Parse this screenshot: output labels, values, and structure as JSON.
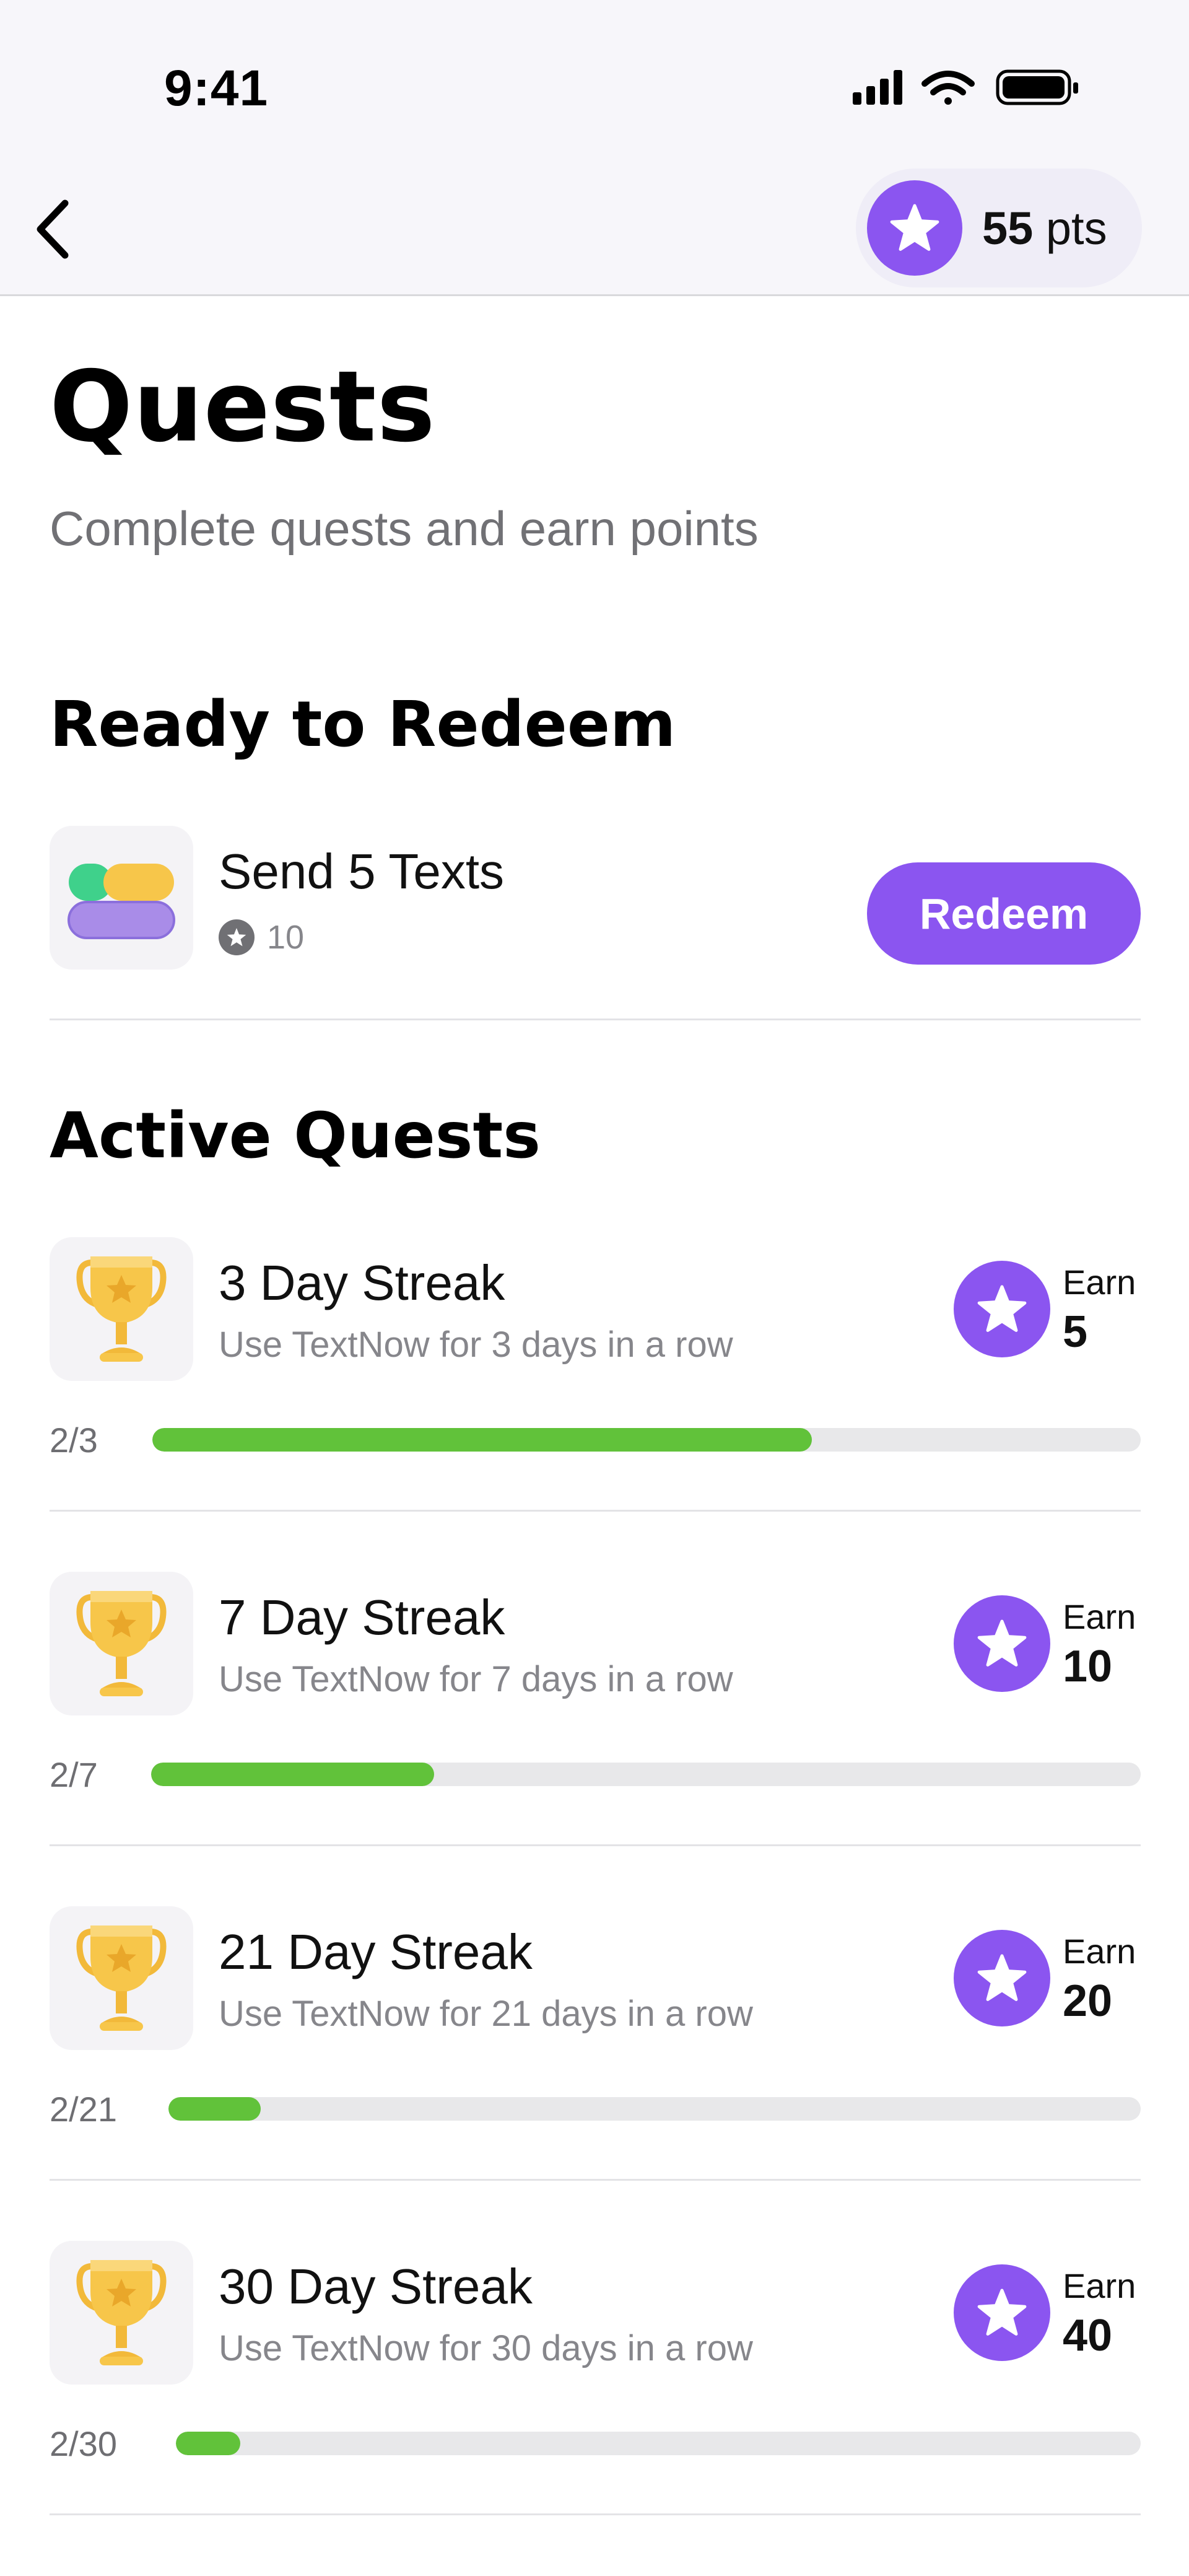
{
  "status_bar": {
    "time": "9:41"
  },
  "header": {
    "points_value": "55",
    "points_unit": "pts"
  },
  "page": {
    "title": "Quests",
    "subtitle": "Complete quests and earn points"
  },
  "ready_section": {
    "title": "Ready to Redeem",
    "item": {
      "title": "Send 5 Texts",
      "points": "10",
      "button_label": "Redeem"
    }
  },
  "active_section": {
    "title": "Active Quests",
    "quests": [
      {
        "title": "3 Day Streak",
        "subtitle": "Use TextNow for 3 days in a row",
        "earn_label": "Earn",
        "earn_value": "5",
        "progress_text": "2/3",
        "progress": 0.667
      },
      {
        "title": "7 Day Streak",
        "subtitle": "Use TextNow for 7 days in a row",
        "earn_label": "Earn",
        "earn_value": "10",
        "progress_text": "2/7",
        "progress": 0.286
      },
      {
        "title": "21 Day Streak",
        "subtitle": "Use TextNow for 21 days in a row",
        "earn_label": "Earn",
        "earn_value": "20",
        "progress_text": "2/21",
        "progress": 0.095
      },
      {
        "title": "30 Day Streak",
        "subtitle": "Use TextNow for 30 days in a row",
        "earn_label": "Earn",
        "earn_value": "40",
        "progress_text": "2/30",
        "progress": 0.067
      }
    ]
  },
  "colors": {
    "accent": "#8b55f0",
    "progress": "#61c23a",
    "trophy": "#f7c64a"
  },
  "icons": [
    "back-chevron",
    "star",
    "signal",
    "wifi",
    "battery",
    "trophy",
    "text-bubbles"
  ]
}
